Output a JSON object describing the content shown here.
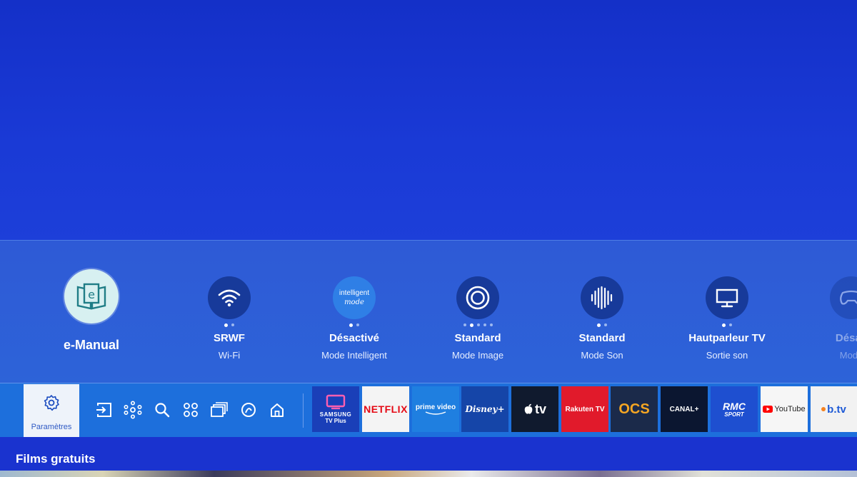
{
  "quick_settings": {
    "emanual": {
      "label": "e-Manual",
      "icon": "book-e-icon",
      "glyph": "e"
    },
    "items": [
      {
        "title": "SRWF",
        "subtitle": "Wi-Fi",
        "icon": "wifi-icon",
        "dots": 2,
        "active_dot": 0
      },
      {
        "title": "Désactivé",
        "subtitle": "Mode Intelligent",
        "icon": "intelligent-mode-icon",
        "icon_text_1": "intelligent",
        "icon_text_2": "mode",
        "dots": 2,
        "active_dot": 0
      },
      {
        "title": "Standard",
        "subtitle": "Mode Image",
        "icon": "picture-mode-icon",
        "dots": 5,
        "active_dot": 1
      },
      {
        "title": "Standard",
        "subtitle": "Mode Son",
        "icon": "sound-mode-icon",
        "dots": 2,
        "active_dot": 0
      },
      {
        "title": "Hautparleur TV",
        "subtitle": "Sortie son",
        "icon": "tv-speaker-icon",
        "dots": 2,
        "active_dot": 0
      },
      {
        "title": "Désac",
        "subtitle": "Mode",
        "icon": "game-mode-icon",
        "dots": 0,
        "active_dot": 0
      }
    ]
  },
  "bottom_bar": {
    "settings_label": "Paramètres",
    "nav_icons": [
      "source-icon",
      "connected-devices-icon",
      "search-icon",
      "apps-icon",
      "ambient-icon",
      "gaming-hub-icon",
      "home-icon"
    ],
    "apps": [
      {
        "name": "samsung-tv-plus",
        "line1": "SAMSUNG",
        "line2": "TV Plus",
        "bg": "#1a3fb8"
      },
      {
        "name": "netflix",
        "line1": "NETFLIX",
        "bg": "#f4f4f4",
        "fg": "#e50914"
      },
      {
        "name": "prime-video",
        "line1": "prime video",
        "bg": "#1f7fe0"
      },
      {
        "name": "disney-plus",
        "line1": "Disney+",
        "bg": "#1545a8"
      },
      {
        "name": "apple-tv",
        "line1": "tv",
        "bg": "#101a2e"
      },
      {
        "name": "rakuten-tv",
        "line1": "Rakuten TV",
        "bg": "#e11a2b"
      },
      {
        "name": "ocs",
        "line1": "OCS",
        "bg": "#1b2a4a",
        "fg": "#f5a623"
      },
      {
        "name": "canal-plus",
        "line1": "CANAL+",
        "bg": "#0b1630"
      },
      {
        "name": "rmc-sport",
        "line1": "RMC",
        "line2": "SPORT",
        "bg": "#1e4fd0"
      },
      {
        "name": "youtube",
        "line1": "YouTube",
        "bg": "#f6f6f6",
        "fg": "#222"
      },
      {
        "name": "b-tv",
        "line1": "b.tv",
        "bg": "#f2f2f2",
        "fg": "#1e5ad6"
      }
    ]
  },
  "section": {
    "title": "Films gratuits"
  }
}
